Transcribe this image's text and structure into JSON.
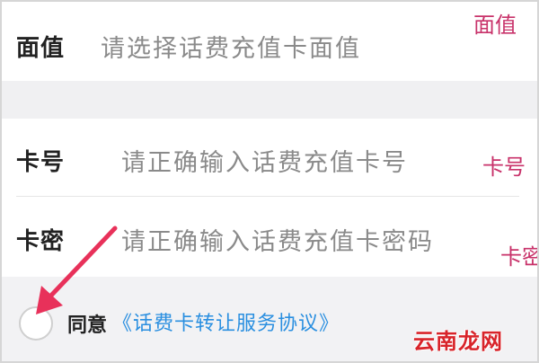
{
  "form": {
    "face_value": {
      "label": "面值",
      "placeholder": "请选择话费充值卡面值",
      "annotation": "面值"
    },
    "card_number": {
      "label": "卡号",
      "placeholder": "请正确输入话费充值卡号",
      "annotation": "卡号"
    },
    "card_password": {
      "label": "卡密",
      "placeholder": "请正确输入话费充值卡密码",
      "annotation": "卡密"
    }
  },
  "agreement": {
    "prefix": "同意",
    "link_text": "《话费卡转让服务协议》"
  },
  "watermark": "云南龙网",
  "colors": {
    "annotation": "#c8326a",
    "link": "#2a8fe0",
    "arrow": "#e8315a",
    "watermark": "#d8242a"
  }
}
